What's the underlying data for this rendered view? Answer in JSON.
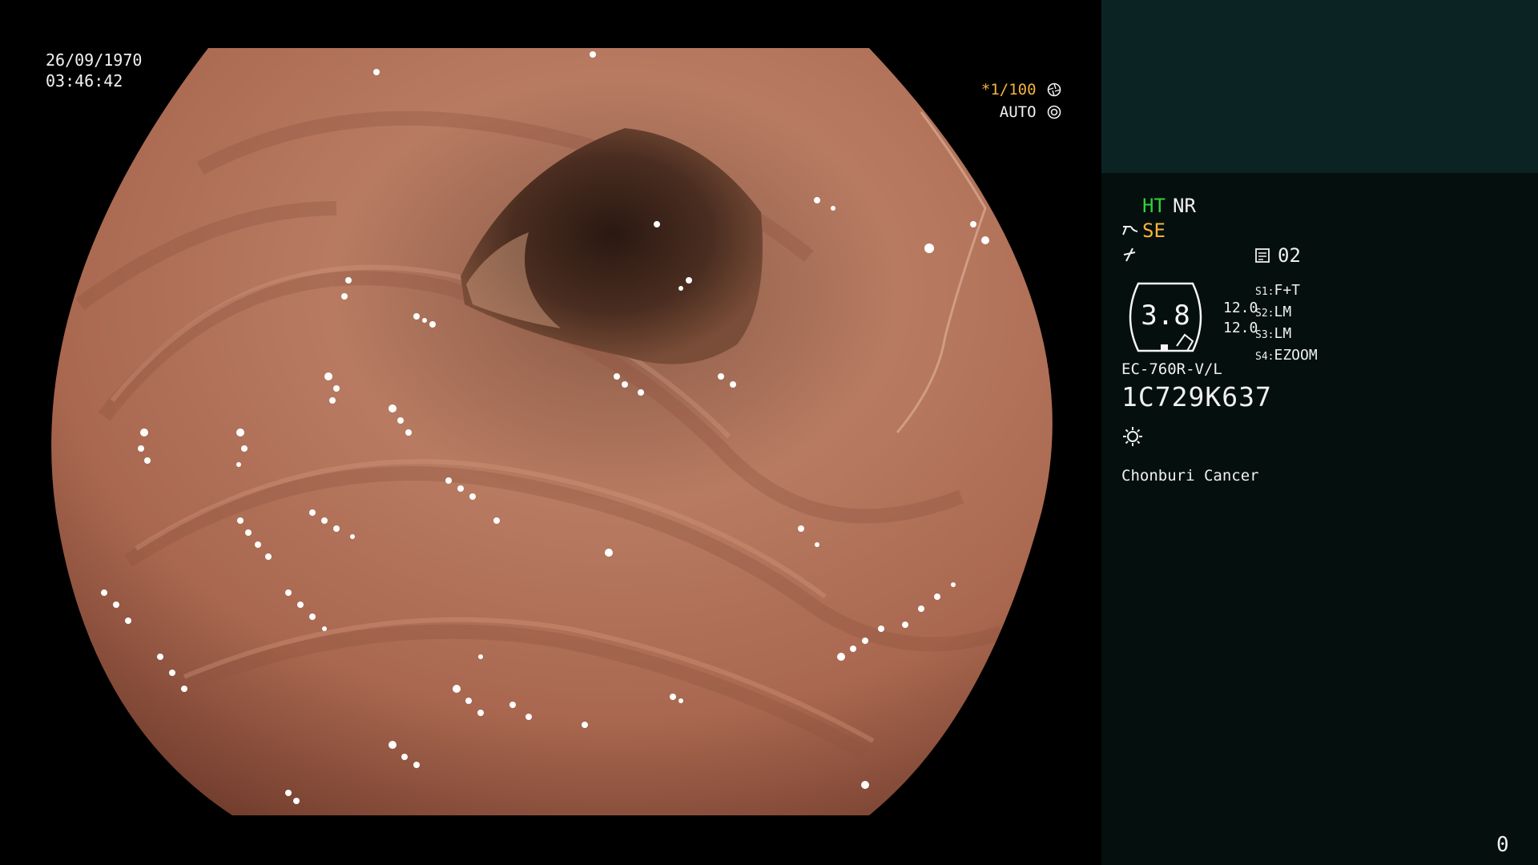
{
  "overlay": {
    "date": "26/09/1970",
    "time": "03:46:42",
    "shutter": "*1/100",
    "iris_mode": "AUTO"
  },
  "panel": {
    "ht_label": "HT",
    "nr_label": "NR",
    "se_label": "SE",
    "memory_number": "02",
    "zoom_value": "3.8",
    "ratio_top": "12.0",
    "ratio_bottom": "12.0",
    "settings": [
      {
        "key": "S1:",
        "value": "F+T"
      },
      {
        "key": "S2:",
        "value": "LM"
      },
      {
        "key": "S3:",
        "value": "LM"
      },
      {
        "key": "S4:",
        "value": "EZOOM"
      }
    ],
    "scope_model": "EC-760R-V/L",
    "serial_number": "1C729K637",
    "institution": "Chonburi Cancer",
    "page_number": "0"
  },
  "colors": {
    "ht_green": "#33d23a",
    "se_orange": "#f3b43a",
    "panel_background": "#040f0e",
    "panel_header": "#0c2323"
  },
  "icons": [
    "shutter-icon",
    "auto-iris-icon",
    "scope-icon",
    "enhance-icon",
    "memory-icon",
    "zoom-indicator-icon",
    "brightness-icon"
  ]
}
